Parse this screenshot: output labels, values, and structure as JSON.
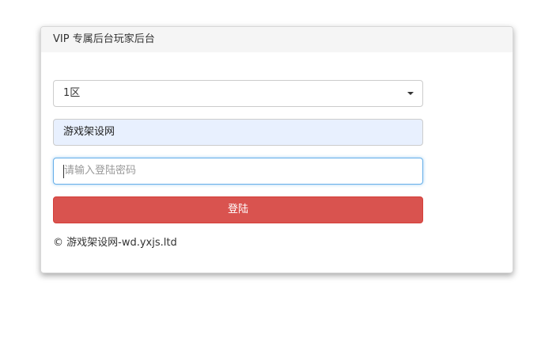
{
  "panel": {
    "title": "VIP 专属后台玩家后台"
  },
  "form": {
    "server_select": {
      "selected": "1区",
      "icon": "caret-down-icon"
    },
    "account_field": {
      "value": "游戏架设网"
    },
    "password_field": {
      "placeholder": "请输入登陆密码"
    },
    "login_button_label": "登陆"
  },
  "footer": {
    "copyright": "© 游戏架设网-wd.yxjs.ltd"
  },
  "colors": {
    "button": "#d9534f",
    "autofill": "#e8f0fe",
    "focus_border": "#66afe9"
  }
}
